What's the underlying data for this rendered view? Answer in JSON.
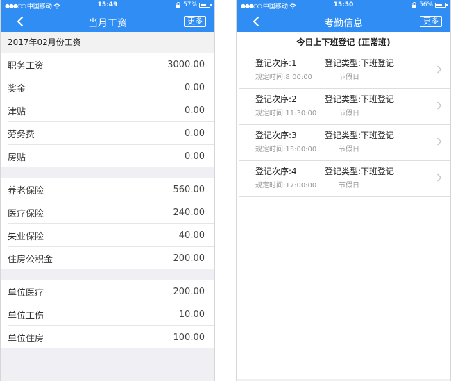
{
  "left_screen": {
    "status": {
      "carrier": "中国移动",
      "time": "15:49",
      "battery": "57%",
      "battery_level": 0.57
    },
    "nav": {
      "title": "当月工资",
      "more": "更多"
    },
    "month_header": "2017年02月份工资",
    "groups": [
      [
        {
          "label": "职务工资",
          "value": "3000.00"
        },
        {
          "label": "奖金",
          "value": "0.00"
        },
        {
          "label": "津贴",
          "value": "0.00"
        },
        {
          "label": "劳务费",
          "value": "0.00"
        },
        {
          "label": "房贴",
          "value": "0.00"
        }
      ],
      [
        {
          "label": "养老保险",
          "value": "560.00"
        },
        {
          "label": "医疗保险",
          "value": "240.00"
        },
        {
          "label": "失业保险",
          "value": "40.00"
        },
        {
          "label": "住房公积金",
          "value": "200.00"
        }
      ],
      [
        {
          "label": "单位医疗",
          "value": "200.00"
        },
        {
          "label": "单位工伤",
          "value": "10.00"
        },
        {
          "label": "单位住房",
          "value": "100.00"
        }
      ]
    ]
  },
  "right_screen": {
    "status": {
      "carrier": "中国移动",
      "time": "15:50",
      "battery": "56%",
      "battery_level": 0.56
    },
    "nav": {
      "title": "考勤信息",
      "more": "更多"
    },
    "section_title": "今日上下班登记 (正常班)",
    "items": [
      {
        "seq": "登记次序:1",
        "type": "登记类型:下班登记",
        "time": "规定时间:8:00:00",
        "day": "节假日"
      },
      {
        "seq": "登记次序:2",
        "type": "登记类型:下班登记",
        "time": "规定时间:11:30:00",
        "day": "节假日"
      },
      {
        "seq": "登记次序:3",
        "type": "登记类型:下班登记",
        "time": "规定时间:13:00:00",
        "day": "节假日"
      },
      {
        "seq": "登记次序:4",
        "type": "登记类型:下班登记",
        "time": "规定时间:17:00:00",
        "day": "节假日"
      }
    ]
  },
  "colors": {
    "accent": "#2f8df4",
    "background": "#efeff4",
    "chevron": "#c7c7cc"
  },
  "icons": {
    "back": "chevron-left-icon",
    "row_arrow": "chevron-right-icon",
    "wifi": "wifi-icon",
    "lock": "rotation-lock-icon",
    "battery": "battery-icon"
  }
}
